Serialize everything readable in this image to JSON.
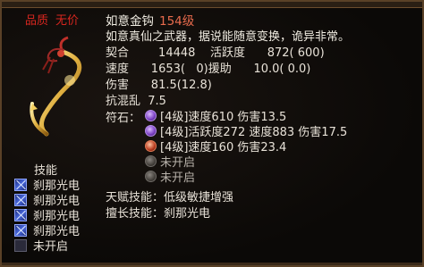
{
  "header": {
    "quality_label": "品质",
    "quality_value": "无价"
  },
  "item": {
    "name": "如意金钩",
    "level": "154级",
    "description": "如意真仙之武器，据说能随意变换，诡异非常。"
  },
  "stats": {
    "row1": "契合        14448    活跃度      872( 600)",
    "row2": "速度      1653(   0)援助      10.0( 0.0)",
    "row3": "伤害      81.5(12.8)",
    "row4": "抗混乱  7.5"
  },
  "slots": {
    "label": "符石：",
    "items": [
      {
        "text": "[4级]速度610 伤害13.5",
        "gem": "purple"
      },
      {
        "text": "[4级]活跃度272 速度883 伤害17.5",
        "gem": "purple"
      },
      {
        "text": "[4级]速度160 伤害23.4",
        "gem": "red"
      },
      {
        "text": "未开启",
        "gem": "empty"
      },
      {
        "text": "未开启",
        "gem": "empty"
      }
    ]
  },
  "skills": {
    "header": "技能",
    "items": [
      {
        "label": "刹那光电",
        "icon": "lightning-skill-icon",
        "active": true
      },
      {
        "label": "刹那光电",
        "icon": "lightning-skill-icon",
        "active": true
      },
      {
        "label": "刹那光电",
        "icon": "lightning-skill-icon",
        "active": true
      },
      {
        "label": "刹那光电",
        "icon": "lightning-skill-icon",
        "active": true
      },
      {
        "label": "未开启",
        "icon": "empty-skill-icon",
        "active": false
      }
    ]
  },
  "talents": {
    "talent": "天赋技能：低级敏捷增强",
    "specialty": "擅长技能：刹那光电"
  },
  "colors": {
    "rarity": "#d8261f",
    "level": "#e86b4d",
    "border": "#5a4127"
  }
}
